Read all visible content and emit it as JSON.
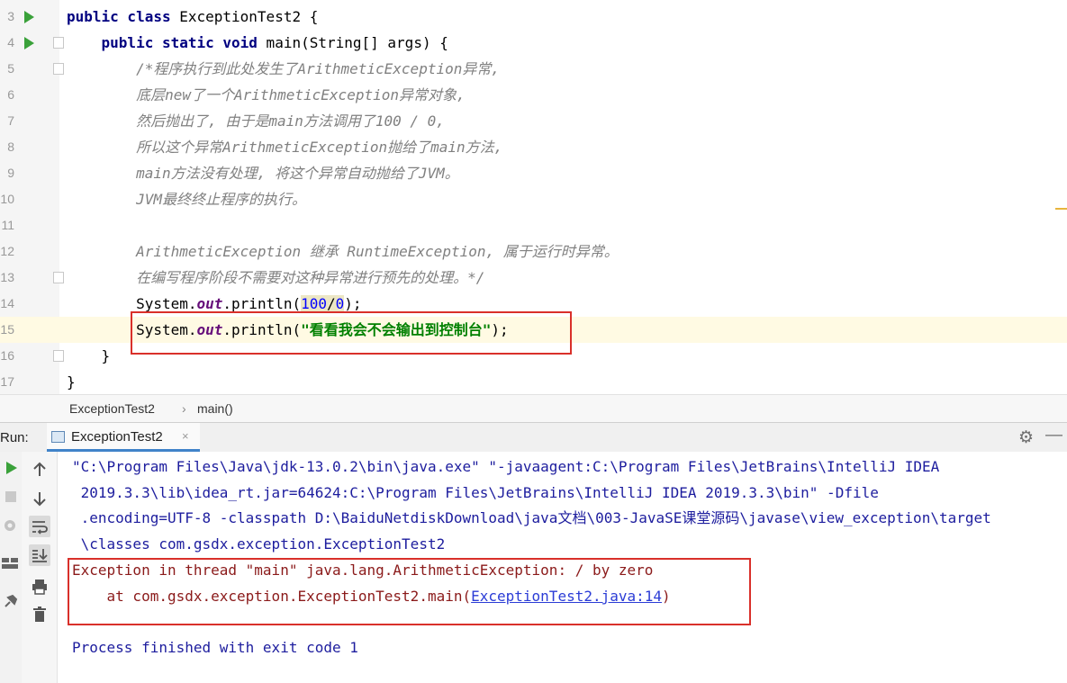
{
  "editor": {
    "lines": [
      {
        "num": "3",
        "parts": [
          {
            "t": "public class",
            "c": "kw"
          },
          {
            "t": " ExceptionTest2 {",
            "c": ""
          }
        ]
      },
      {
        "num": "4",
        "parts": [
          {
            "t": "    public static void",
            "c": "kw"
          },
          {
            "t": " main(String[] args) {",
            "c": ""
          }
        ]
      },
      {
        "num": "5",
        "parts": [
          {
            "t": "        /*程序执行到此处发生了ArithmeticException异常,",
            "c": "cmt"
          }
        ]
      },
      {
        "num": "6",
        "parts": [
          {
            "t": "        底层new了一个ArithmeticException异常对象,",
            "c": "cmt"
          }
        ]
      },
      {
        "num": "7",
        "parts": [
          {
            "t": "        然后抛出了, 由于是main方法调用了100 / 0,",
            "c": "cmt"
          }
        ]
      },
      {
        "num": "8",
        "parts": [
          {
            "t": "        所以这个异常ArithmeticException抛给了main方法,",
            "c": "cmt"
          }
        ]
      },
      {
        "num": "9",
        "parts": [
          {
            "t": "        main方法没有处理, 将这个异常自动抛给了JVM。",
            "c": "cmt"
          }
        ]
      },
      {
        "num": "10",
        "parts": [
          {
            "t": "        JVM最终终止程序的执行。",
            "c": "cmt"
          }
        ]
      },
      {
        "num": "11",
        "parts": []
      },
      {
        "num": "12",
        "parts": [
          {
            "t": "        ArithmeticException 继承 RuntimeException, 属于运行时异常。",
            "c": "cmt"
          }
        ]
      },
      {
        "num": "13",
        "parts": [
          {
            "t": "        在编写程序阶段不需要对这种异常进行预先的处理。*/",
            "c": "cmt"
          }
        ]
      },
      {
        "num": "14",
        "parts": [
          {
            "t": "        System.",
            "c": ""
          },
          {
            "t": "out",
            "c": "fld"
          },
          {
            "t": ".println(",
            "c": ""
          },
          {
            "t": "100",
            "c": "num hl"
          },
          {
            "t": "/",
            "c": "hl"
          },
          {
            "t": "0",
            "c": "num hl"
          },
          {
            "t": ");",
            "c": ""
          }
        ]
      },
      {
        "num": "15",
        "parts": [
          {
            "t": "        System.",
            "c": ""
          },
          {
            "t": "out",
            "c": "fld"
          },
          {
            "t": ".println(",
            "c": ""
          },
          {
            "t": "\"看看我会不会输出到控制台\"",
            "c": "str"
          },
          {
            "t": ");",
            "c": ""
          }
        ]
      },
      {
        "num": "16",
        "parts": [
          {
            "t": "    }",
            "c": ""
          }
        ]
      },
      {
        "num": "17",
        "parts": [
          {
            "t": "}",
            "c": ""
          }
        ]
      }
    ]
  },
  "breadcrumb": {
    "class_name": "ExceptionTest2",
    "separator": "›",
    "method": "main()"
  },
  "run_panel": {
    "label": "Run:",
    "tab_label": "ExceptionTest2",
    "tab_close": "×",
    "icons": {
      "left": [
        "run-icon",
        "stop-icon",
        "debug-settings-icon",
        "layout-icon",
        "pin-icon"
      ],
      "mid": [
        "scroll-up-icon",
        "scroll-down-icon",
        "soft-wrap-icon",
        "scroll-to-end-icon",
        "print-icon",
        "clear-icon"
      ]
    }
  },
  "console": {
    "command": [
      "\"C:\\Program Files\\Java\\jdk-13.0.2\\bin\\java.exe\" \"-javaagent:C:\\Program Files\\JetBrains\\IntelliJ IDEA",
      " 2019.3.3\\lib\\idea_rt.jar=64624:C:\\Program Files\\JetBrains\\IntelliJ IDEA 2019.3.3\\bin\" -Dfile",
      " .encoding=UTF-8 -classpath D:\\BaiduNetdiskDownload\\java文档\\003-JavaSE课堂源码\\javase\\view_exception\\target",
      " \\classes com.gsdx.exception.ExceptionTest2"
    ],
    "exception_line": "Exception in thread \"main\" java.lang.ArithmeticException: / by zero",
    "stack_prefix": "    at com.gsdx.exception.ExceptionTest2.main(",
    "stack_link": "ExceptionTest2.java:14",
    "stack_suffix": ")",
    "exit_line": "Process finished with exit code 1"
  },
  "colors": {
    "highlight_box": "#d9302a",
    "current_line": "#fffae3",
    "keyword": "#000080",
    "string": "#008000"
  }
}
